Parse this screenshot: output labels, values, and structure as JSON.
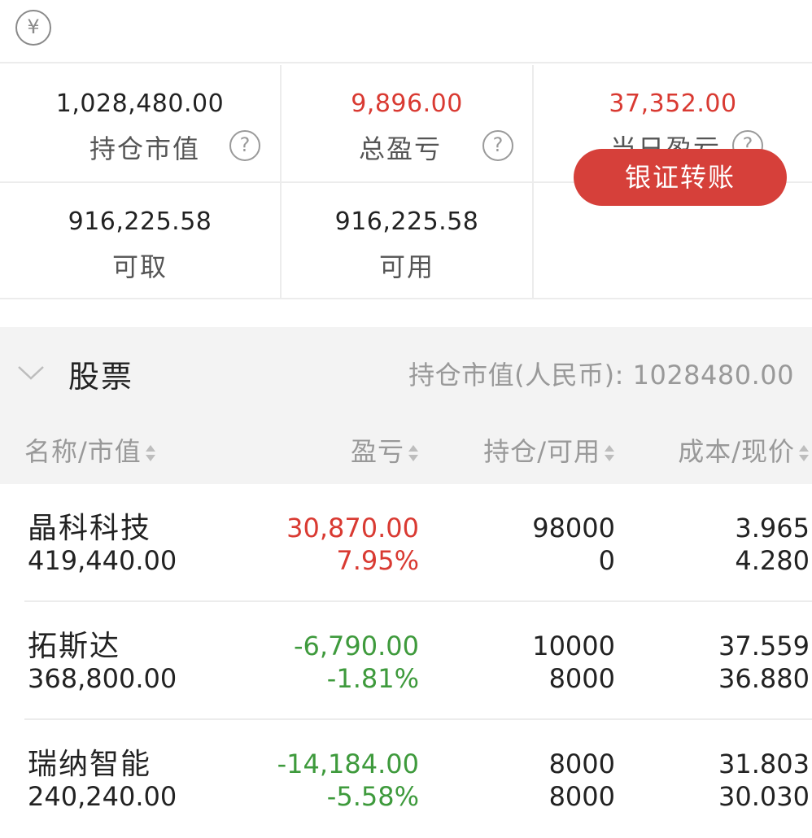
{
  "topbar": {
    "currency_icon": "¥"
  },
  "summary": {
    "market_value": {
      "value": "1,028,480.00",
      "label": "持仓市值"
    },
    "total_pl": {
      "value": "9,896.00",
      "label": "总盈亏"
    },
    "daily_pl": {
      "value": "37,352.00",
      "label": "当日盈亏"
    },
    "withdrawable": {
      "value": "916,225.58",
      "label": "可取"
    },
    "available": {
      "value": "916,225.58",
      "label": "可用"
    },
    "transfer_button": "银证转账",
    "help_icon": "?"
  },
  "stocks_section": {
    "title": "股票",
    "total_label": "持仓市值(人民币):",
    "total_value": "1028480.00",
    "columns": [
      "名称/市值",
      "盈亏",
      "持仓/可用",
      "成本/现价"
    ]
  },
  "rows": [
    {
      "name": "晶科科技",
      "market_value": "419,440.00",
      "pl": "30,870.00",
      "pl_pct": "7.95%",
      "position": "98000",
      "available": "0",
      "cost": "3.965",
      "price": "4.280",
      "trend": "up"
    },
    {
      "name": "拓斯达",
      "market_value": "368,800.00",
      "pl": "-6,790.00",
      "pl_pct": "-1.81%",
      "position": "10000",
      "available": "8000",
      "cost": "37.559",
      "price": "36.880",
      "trend": "down"
    },
    {
      "name": "瑞纳智能",
      "market_value": "240,240.00",
      "pl": "-14,184.00",
      "pl_pct": "-5.58%",
      "position": "8000",
      "available": "8000",
      "cost": "31.803",
      "price": "30.030",
      "trend": "down"
    }
  ],
  "colors": {
    "up": "#d93a32",
    "down": "#3e9a3c",
    "accent": "#d6403a"
  }
}
